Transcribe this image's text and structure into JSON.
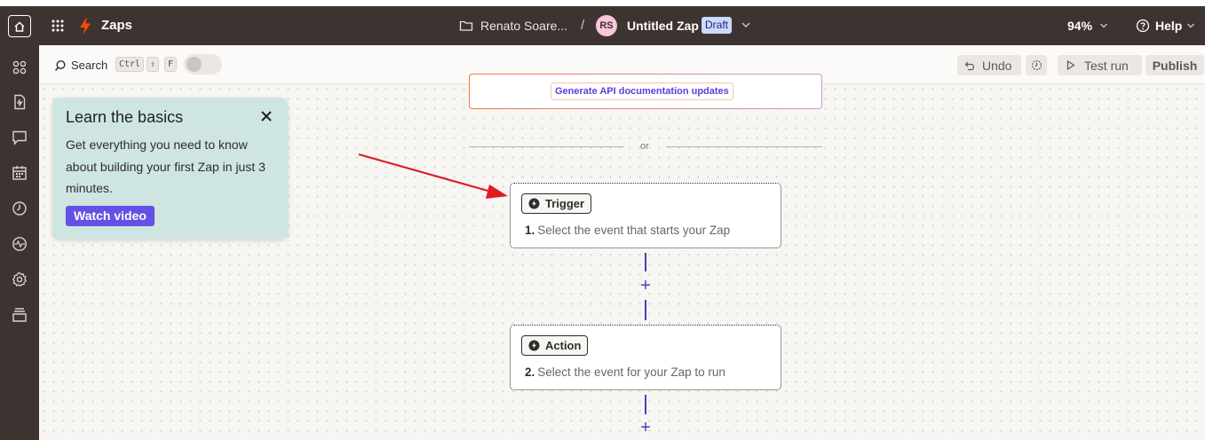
{
  "topbar": {
    "app_title": "Zaps",
    "folder_name": "Renato Soare...",
    "separator": "/",
    "avatar_initials": "RS",
    "zap_name": "Untitled Zap",
    "status_badge": "Draft",
    "zoom": "94%",
    "help_label": "Help"
  },
  "sidebar": {
    "icons": [
      "home-icon",
      "apps-icon",
      "zaps-icon",
      "interfaces-icon",
      "calendar-icon",
      "history-icon",
      "activity-icon",
      "settings-icon",
      "archive-icon"
    ]
  },
  "toolbar": {
    "search_label": "Search",
    "shortcut_keys": [
      "Ctrl",
      "⇧",
      "F"
    ],
    "undo_label": "Undo",
    "test_run_label": "Test run",
    "publish_label": "Publish"
  },
  "canvas": {
    "ai_suggestion": "Generate API documentation updates",
    "divider_text": "or",
    "trigger": {
      "chip_label": "Trigger",
      "step_number": "1.",
      "description": "Select the event that starts your Zap"
    },
    "action": {
      "chip_label": "Action",
      "step_number": "2.",
      "description": "Select the event for your Zap to run"
    },
    "add_step_symbol": "+"
  },
  "learn_card": {
    "title": "Learn the basics",
    "body": "Get everything you need to know about building your first Zap in just 3 minutes.",
    "button_label": "Watch video"
  },
  "colors": {
    "topbar_bg": "#3d3431",
    "accent_purple": "#6350e6",
    "connector": "#4a3fbf",
    "bolt_orange": "#ff4a00",
    "learn_card_bg": "#cfe5e1",
    "annotation_arrow": "#e01b24"
  }
}
